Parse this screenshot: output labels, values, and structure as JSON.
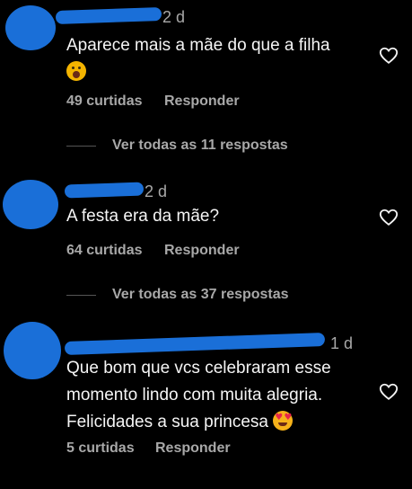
{
  "comments": [
    {
      "time": "2 d",
      "text": "Aparece mais a mãe do que a filha",
      "emoji": "face-screaming-emoji",
      "likes": "49 curtidas",
      "reply_label": "Responder",
      "view_replies": "Ver todas as 11 respostas"
    },
    {
      "time": "2 d",
      "text": "A festa era da mãe?",
      "likes": "64 curtidas",
      "reply_label": "Responder",
      "view_replies": "Ver todas as 37 respostas"
    },
    {
      "time": "1 d",
      "text_lines": [
        "Que bom que vcs celebraram esse",
        "momento lindo com muita alegria.",
        "Felicidades a sua princesa"
      ],
      "emoji": "heart-eyes-emoji",
      "likes": "5 curtidas",
      "reply_label": "Responder"
    }
  ],
  "colors": {
    "background": "#000000",
    "text": "#f5f5f5",
    "secondary_text": "#a8a8a8",
    "redaction_blue": "#1a6fd8"
  },
  "icons": {
    "like": "heart-outline-icon"
  }
}
